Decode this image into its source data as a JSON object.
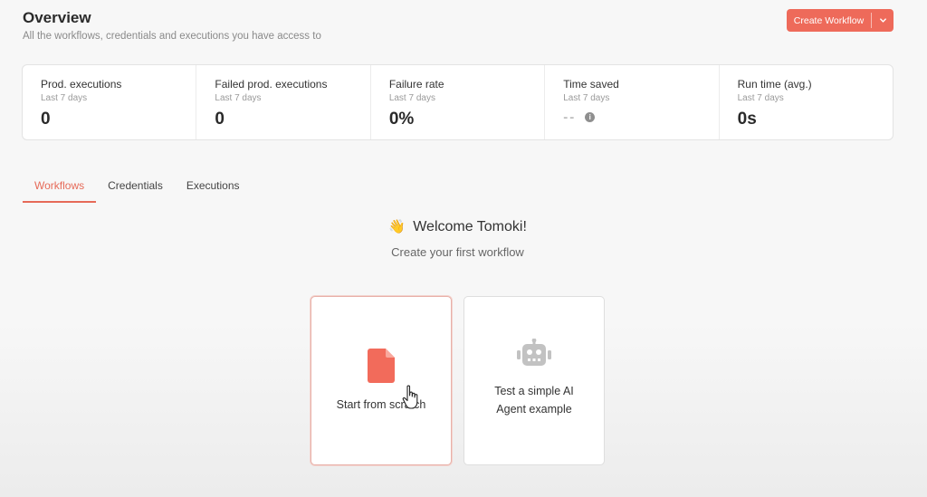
{
  "header": {
    "title": "Overview",
    "subtitle": "All the workflows, credentials and executions you have access to"
  },
  "actions": {
    "create_label": "Create Workflow",
    "dropdown_icon": "chevron-down-icon"
  },
  "stats": [
    {
      "label": "Prod. executions",
      "period": "Last 7 days",
      "value": "0"
    },
    {
      "label": "Failed prod. executions",
      "period": "Last 7 days",
      "value": "0"
    },
    {
      "label": "Failure rate",
      "period": "Last 7 days",
      "value": "0%"
    },
    {
      "label": "Time saved",
      "period": "Last 7 days",
      "value": "--"
    },
    {
      "label": "Run time (avg.)",
      "period": "Last 7 days",
      "value": "0s"
    }
  ],
  "tabs": [
    {
      "label": "Workflows",
      "active": true
    },
    {
      "label": "Credentials",
      "active": false
    },
    {
      "label": "Executions",
      "active": false
    }
  ],
  "welcome": {
    "emoji": "👋",
    "title": "Welcome Tomoki!",
    "subtitle": "Create your first workflow"
  },
  "cards": {
    "scratch": {
      "label": "Start from scratch",
      "icon": "document-icon"
    },
    "agent": {
      "label": "Test a simple AI Agent example",
      "icon": "robot-icon"
    }
  },
  "colors": {
    "accent": "#ee6a5a",
    "doc_icon": "#f26b5b",
    "robot_icon": "#c2c2c2"
  }
}
